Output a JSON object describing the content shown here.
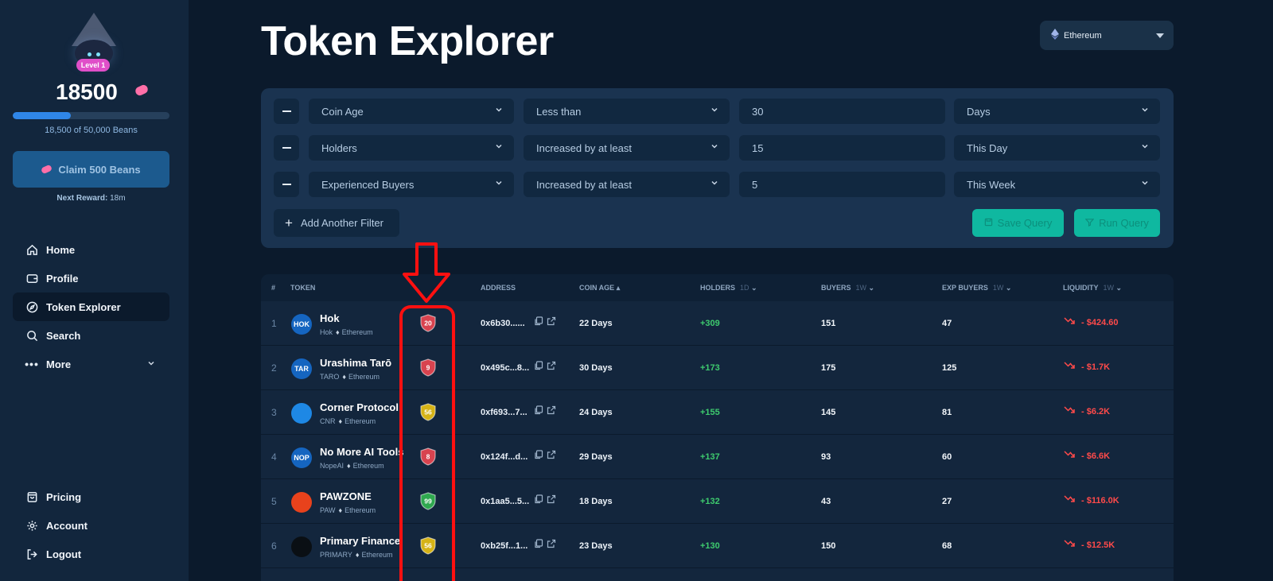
{
  "sidebar": {
    "level": "Level 1",
    "beans": "18500",
    "progress_fraction": 0.37,
    "progress_text": "18,500 of 50,000 Beans",
    "claim_label": "Claim 500 Beans",
    "next_reward_label": "Next Reward:",
    "next_reward_value": "18m",
    "nav": [
      {
        "label": "Home",
        "icon": "home-icon"
      },
      {
        "label": "Profile",
        "icon": "wallet-icon"
      },
      {
        "label": "Token Explorer",
        "icon": "compass-icon",
        "active": true
      },
      {
        "label": "Search",
        "icon": "search-icon"
      },
      {
        "label": "More",
        "icon": "more-icon"
      }
    ],
    "bottom_nav": [
      {
        "label": "Pricing",
        "icon": "bag-icon"
      },
      {
        "label": "Account",
        "icon": "gear-icon"
      },
      {
        "label": "Logout",
        "icon": "logout-icon"
      }
    ]
  },
  "page": {
    "title": "Token Explorer",
    "chain": "Ethereum"
  },
  "filters": [
    {
      "field": "Coin Age",
      "op": "Less than",
      "value": "30",
      "unit": "Days"
    },
    {
      "field": "Holders",
      "op": "Increased by at least",
      "value": "15",
      "unit": "This Day"
    },
    {
      "field": "Experienced Buyers",
      "op": "Increased by at least",
      "value": "5",
      "unit": "This Week"
    }
  ],
  "filter_actions": {
    "add": "Add Another Filter",
    "save": "Save Query",
    "run": "Run Query"
  },
  "table": {
    "headers": {
      "rank": "#",
      "token": "TOKEN",
      "address": "ADDRESS",
      "age": "COIN AGE",
      "holders": "HOLDERS",
      "holders_period": "1D",
      "buyers": "BUYERS",
      "buyers_period": "1W",
      "exp_buyers": "EXP BUYERS",
      "exp_buyers_period": "1W",
      "liquidity": "LIQUIDITY",
      "liquidity_period": "1W"
    },
    "rows": [
      {
        "rank": "1",
        "logo": "HOK",
        "logo_color": "#1565c0",
        "name": "Hok",
        "symbol": "Hok",
        "chain": "Ethereum",
        "score": "20",
        "score_color": "#d8434f",
        "address": "0x6b30......",
        "age": "22 Days",
        "holders": "+309",
        "buyers": "151",
        "exp_buyers": "47",
        "liquidity": "- $424.60"
      },
      {
        "rank": "2",
        "logo": "TAR",
        "logo_color": "#1565c0",
        "name": "Urashima Tarō",
        "symbol": "TARO",
        "chain": "Ethereum",
        "score": "9",
        "score_color": "#d8434f",
        "address": "0x495c...8...",
        "age": "30 Days",
        "holders": "+173",
        "buyers": "175",
        "exp_buyers": "125",
        "liquidity": "- $1.7K"
      },
      {
        "rank": "3",
        "logo": "",
        "logo_color": "#1e88e5",
        "name": "Corner Protocol",
        "symbol": "CNR",
        "chain": "Ethereum",
        "score": "56",
        "score_color": "#d6b316",
        "address": "0xf693...7...",
        "age": "24 Days",
        "holders": "+155",
        "buyers": "145",
        "exp_buyers": "81",
        "liquidity": "- $6.2K"
      },
      {
        "rank": "4",
        "logo": "NOP",
        "logo_color": "#1565c0",
        "name": "No More AI Tools",
        "symbol": "NopeAI",
        "chain": "Ethereum",
        "score": "8",
        "score_color": "#d8434f",
        "address": "0x124f...d...",
        "age": "29 Days",
        "holders": "+137",
        "buyers": "93",
        "exp_buyers": "60",
        "liquidity": "- $6.6K"
      },
      {
        "rank": "5",
        "logo": "",
        "logo_color": "#e8421c",
        "name": "PAWZONE",
        "symbol": "PAW",
        "chain": "Ethereum",
        "score": "99",
        "score_color": "#2fa84f",
        "address": "0x1aa5...5...",
        "age": "18 Days",
        "holders": "+132",
        "buyers": "43",
        "exp_buyers": "27",
        "liquidity": "- $116.0K"
      },
      {
        "rank": "6",
        "logo": "",
        "logo_color": "#0a0f14",
        "name": "Primary Finance",
        "symbol": "PRIMARY",
        "chain": "Ethereum",
        "score": "56",
        "score_color": "#d6b316",
        "address": "0xb25f...1...",
        "age": "23 Days",
        "holders": "+130",
        "buyers": "150",
        "exp_buyers": "68",
        "liquidity": "- $12.5K"
      }
    ]
  }
}
